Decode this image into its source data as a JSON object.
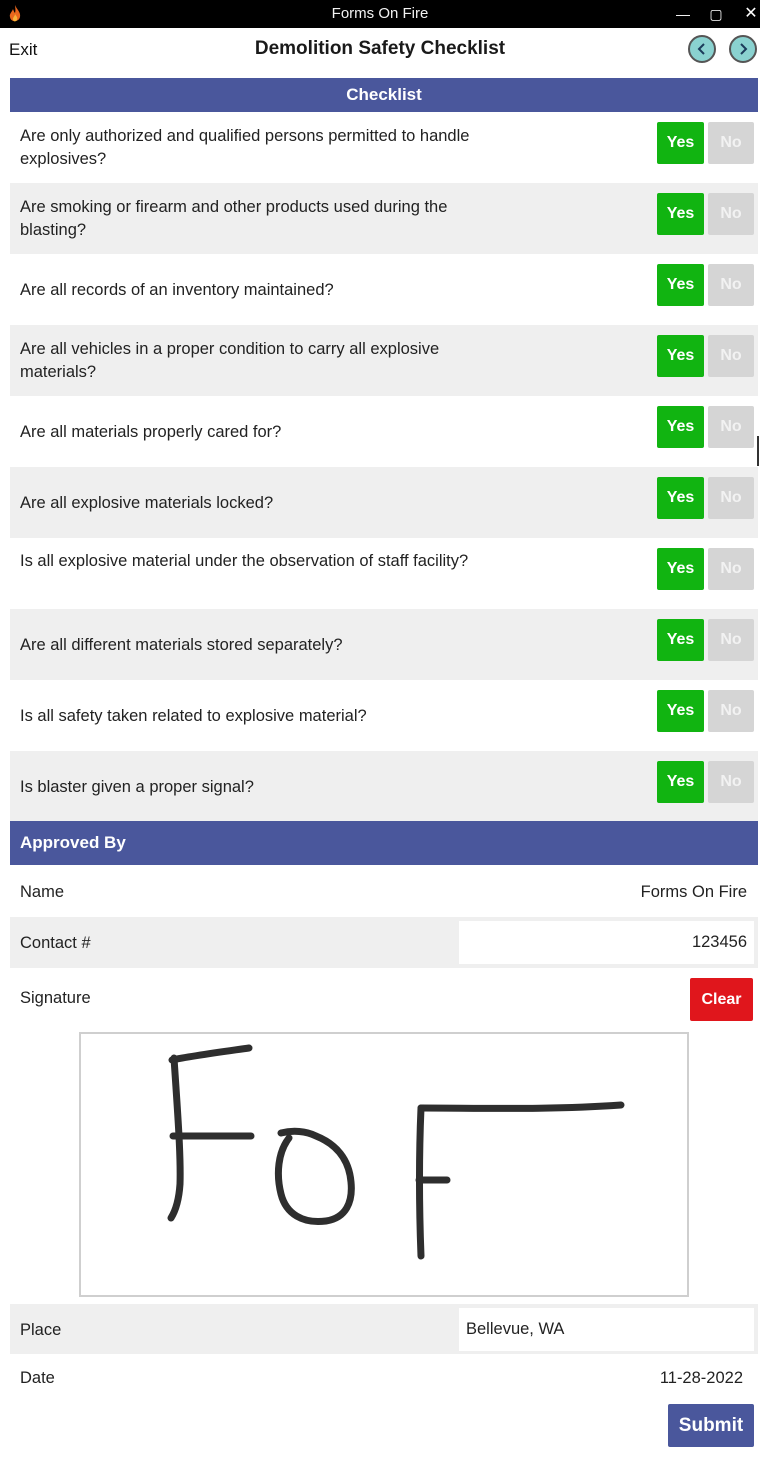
{
  "window": {
    "title": "Forms On Fire",
    "minimize": "—",
    "maximize": "▢",
    "close": "✕"
  },
  "header": {
    "exit_label": "Exit",
    "title": "Demolition Safety Checklist"
  },
  "checklist": {
    "heading": "Checklist",
    "yes_label": "Yes",
    "no_label": "No",
    "questions": [
      {
        "text": "Are only authorized and qualified persons permitted to handle explosives?",
        "answer": "Yes"
      },
      {
        "text": "Are smoking or firearm and other products used during the blasting?",
        "answer": "Yes"
      },
      {
        "text": "Are all records of an inventory maintained?",
        "answer": "Yes"
      },
      {
        "text": "Are all vehicles in a proper condition to carry all explosive materials?",
        "answer": "Yes"
      },
      {
        "text": "Are all materials properly cared for?",
        "answer": "Yes"
      },
      {
        "text": "Are all explosive materials locked?",
        "answer": "Yes"
      },
      {
        "text": "Is all explosive material under the observation of staff facility?",
        "answer": "Yes"
      },
      {
        "text": "Are all different materials stored separately?",
        "answer": "Yes"
      },
      {
        "text": "Is all safety taken related to explosive material?",
        "answer": "Yes"
      },
      {
        "text": "Is blaster given a proper signal?",
        "answer": "Yes"
      }
    ]
  },
  "approval": {
    "heading": "Approved By",
    "name_label": "Name",
    "name_value": "Forms On Fire",
    "contact_label": "Contact #",
    "contact_value": "123456",
    "signature_label": "Signature",
    "clear_label": "Clear",
    "signature_text": "FoF",
    "place_label": "Place",
    "place_value": "Bellevue, WA",
    "date_label": "Date",
    "date_value": "11-28-2022",
    "submit_label": "Submit"
  },
  "colors": {
    "accent": "#4a579c",
    "yes_selected": "#11b411",
    "no_unselected": "#d5d5d5",
    "clear": "#e0161c"
  }
}
